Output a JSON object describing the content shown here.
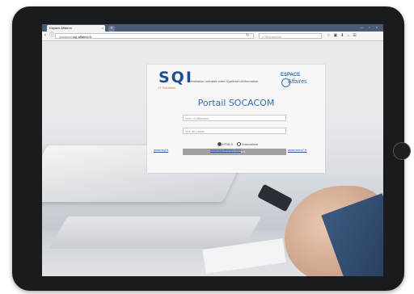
{
  "browser": {
    "tab_title": "Espace Affaires",
    "tab_close": "×",
    "new_tab": "+",
    "url_prefix": "socacom.",
    "url_domain": "sqi-affaires.fr",
    "search_placeholder": "Rechercher",
    "window_controls": "— ▫ ×"
  },
  "login": {
    "logo_text": "SQI",
    "logo_sub": "IT Solutions",
    "tagline": "Ventilation unicable votre Système d'Information",
    "espace_logo_line1": "ESPACE",
    "espace_logo_line2": "Affaires",
    "portal_title": "Portail SOCACOM",
    "username_placeholder": "Nom d'utilisateur",
    "password_placeholder": "Mot de passe",
    "mode_html": "HTML5",
    "mode_alt": "Standalone",
    "connect_label": "Connexion"
  },
  "footer_links": [
    "www.sqi.fr",
    "www.sqi-affaires.com",
    "www.terra7.fr"
  ]
}
